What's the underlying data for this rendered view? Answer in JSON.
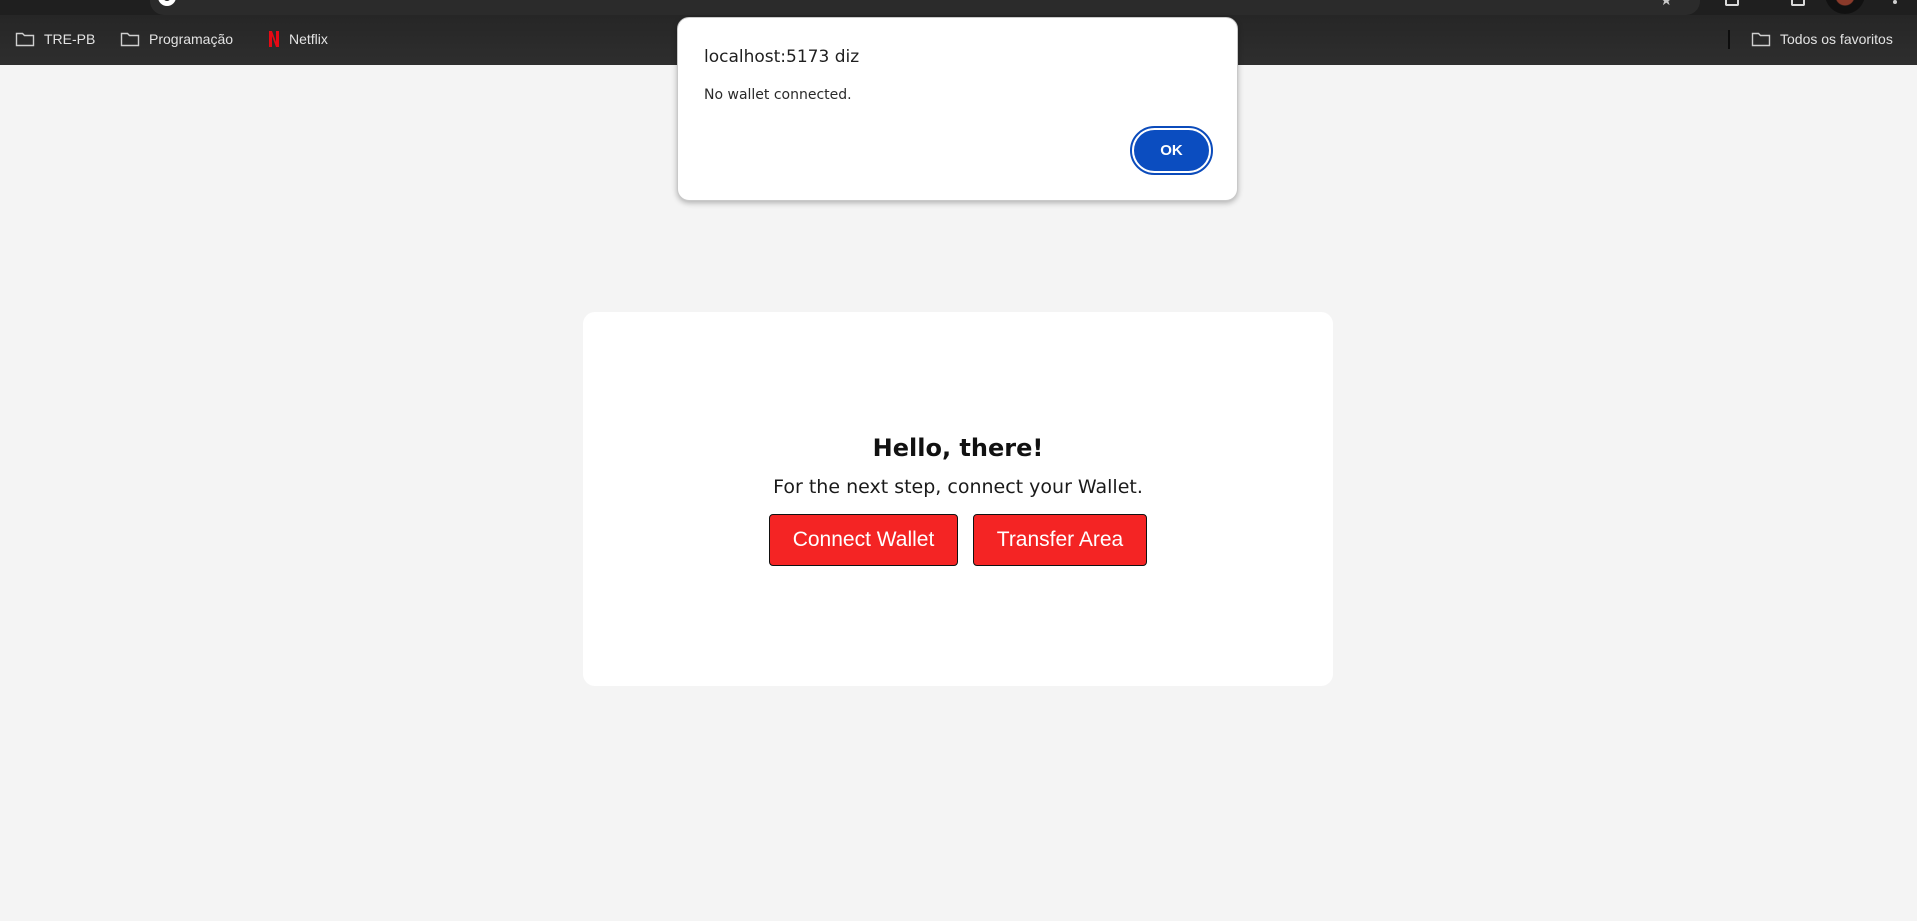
{
  "bookmarks": [
    {
      "label": "TRE-PB",
      "icon": "folder-icon"
    },
    {
      "label": "Programação",
      "icon": "folder-icon"
    },
    {
      "label": "Netflix",
      "icon": "netflix-icon"
    }
  ],
  "bookmarks_right": {
    "label": "Todos os favoritos",
    "icon": "folder-icon"
  },
  "alert": {
    "title": "localhost:5173 diz",
    "message": "No wallet connected.",
    "ok_label": "OK"
  },
  "card": {
    "title": "Hello, there!",
    "subtitle": "For the next step, connect your Wallet.",
    "connect_label": "Connect Wallet",
    "transfer_label": "Transfer Area"
  },
  "colors": {
    "page_background": "#f4f4f4",
    "chrome_dark": "#2b2b2b",
    "primary_blue": "#0b4dc0",
    "button_red": "#f42424",
    "netflix_red": "#e50914"
  }
}
